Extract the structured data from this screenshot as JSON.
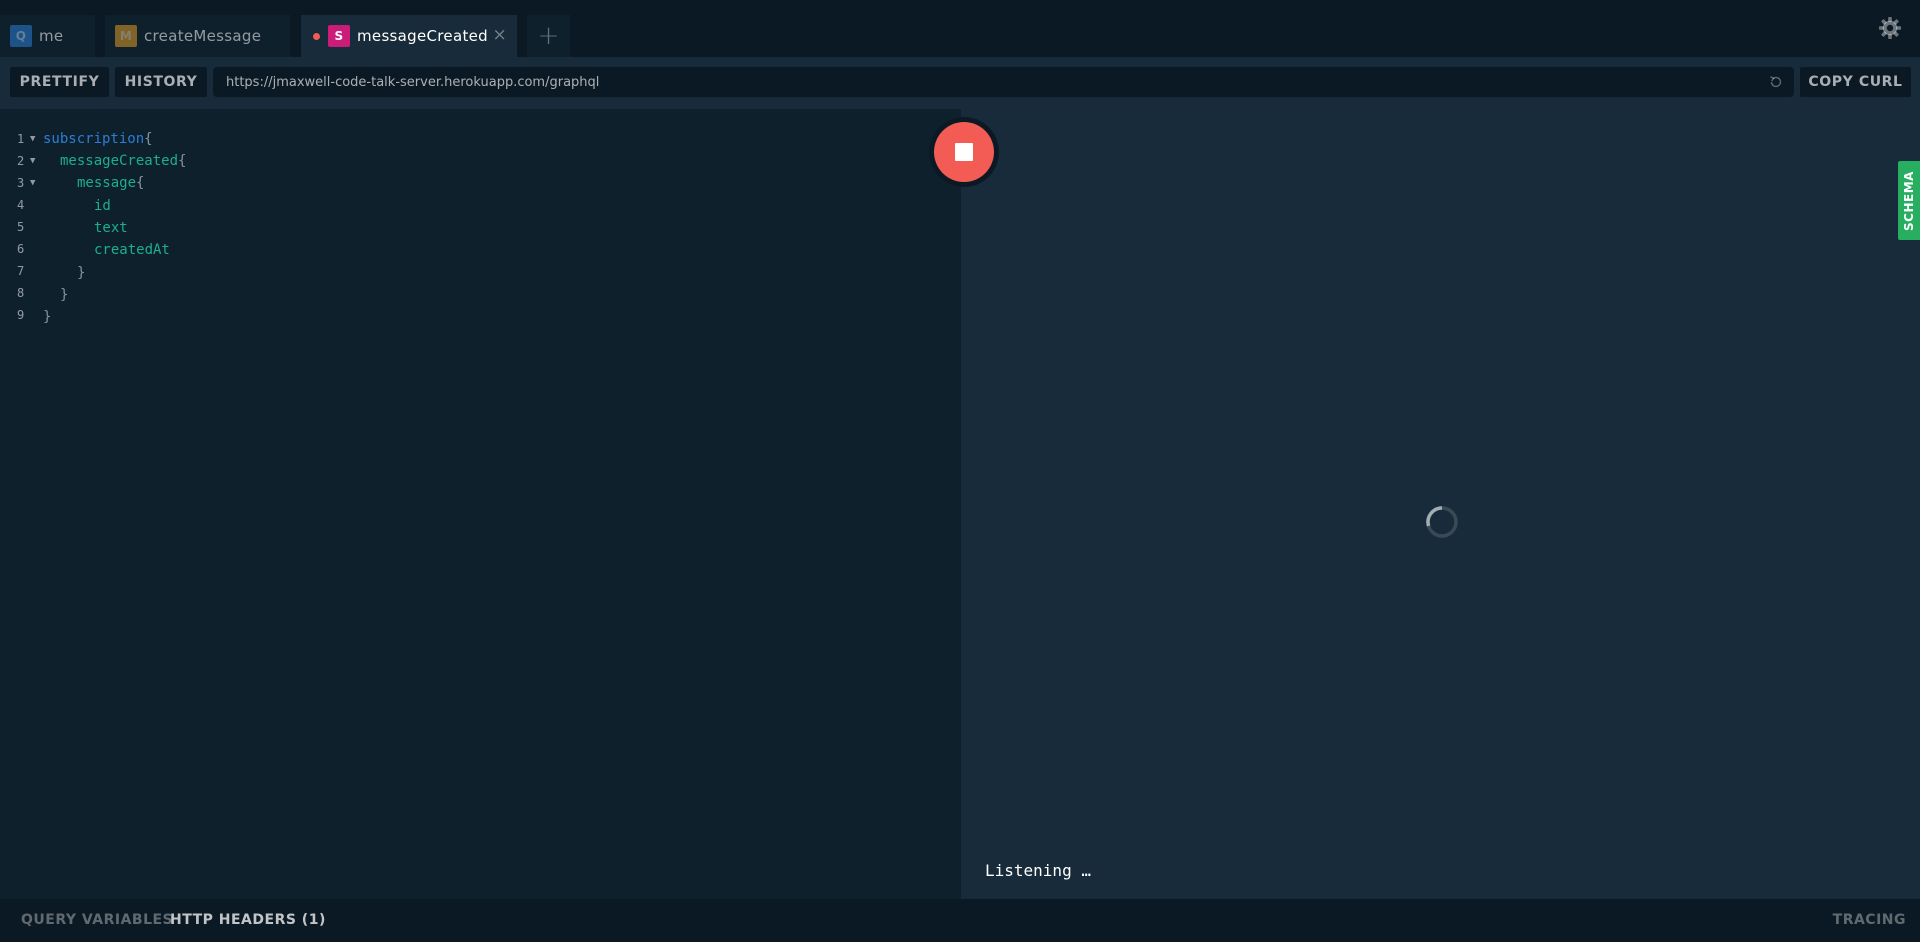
{
  "tabs": [
    {
      "badge": "Q",
      "label": "me"
    },
    {
      "badge": "M",
      "label": "createMessage"
    },
    {
      "badge": "S",
      "label": "messageCreated",
      "close": "×"
    }
  ],
  "new_tab_symbol": "+",
  "toolbar": {
    "prettify_label": "PRETTIFY",
    "history_label": "HISTORY",
    "endpoint_url": "https://jmaxwell-code-talk-server.herokuapp.com/graphql",
    "copy_curl_label": "COPY CURL"
  },
  "editor": {
    "line_numbers": [
      "1",
      "2",
      "3",
      "4",
      "5",
      "6",
      "7",
      "8",
      "9"
    ],
    "lines": [
      {
        "keyword": "subscription",
        "brace": "{"
      },
      {
        "field": "messageCreated",
        "brace": "{"
      },
      {
        "field": "message",
        "brace": "{"
      },
      {
        "field": "id"
      },
      {
        "field": "text"
      },
      {
        "field": "createdAt"
      },
      {
        "brace": "}"
      },
      {
        "brace": "}"
      },
      {
        "brace": "}"
      }
    ]
  },
  "result": {
    "status_text": "Listening …",
    "schema_label": "SCHEMA"
  },
  "bottom": {
    "query_variables_label": "QUERY VARIABLES",
    "http_headers_label": "HTTP HEADERS (1)",
    "tracing_label": "TRACING"
  },
  "colors": {
    "background": "#0b1924",
    "editor_bg": "#0f202d",
    "panel_bg": "#172b3a",
    "keyword": "#2a7ed3",
    "field": "#1cae8f",
    "stop_button": "#f25c54",
    "schema_tab": "#27ae60",
    "subscription_badge": "#cb1c7a"
  },
  "icons": [
    "settings-gear-icon",
    "reload-icon",
    "stop-icon",
    "loading-spinner-icon",
    "close-icon",
    "plus-icon"
  ]
}
